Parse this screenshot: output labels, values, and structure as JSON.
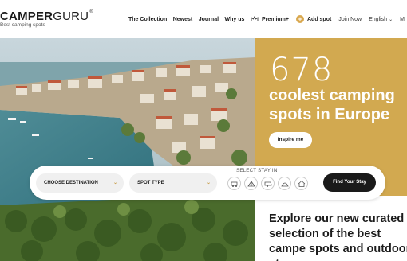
{
  "header": {
    "logo_main": "CAMPER",
    "logo_accent": "GURU",
    "logo_mark": "®",
    "tagline": "Best camping spots",
    "nav": [
      "The Collection",
      "Newest",
      "Journal",
      "Why us"
    ],
    "premium_label": "Premium+",
    "add_spot_label": "Add spot",
    "join_label": "Join Now",
    "language_label": "English",
    "menu_label": "M"
  },
  "hero": {
    "count": "678",
    "title": "coolest camping spots in Europe",
    "inspire_button": "Inspire me"
  },
  "search": {
    "destination_label": "CHOOSE DESTINATION",
    "spot_type_label": "SPOT TYPE",
    "stay_in_label": "SELECT STAY IN",
    "stay_options": [
      "camper-icon",
      "tent-icon",
      "caravan-icon",
      "glamping-icon",
      "house-icon"
    ],
    "find_button": "Find Your Stay"
  },
  "explore": {
    "text": "Explore our new curated selection of the best campe spots and outdoor stays"
  },
  "colors": {
    "accent_gold": "#d2a950",
    "dark_button": "#1a1a1a"
  }
}
